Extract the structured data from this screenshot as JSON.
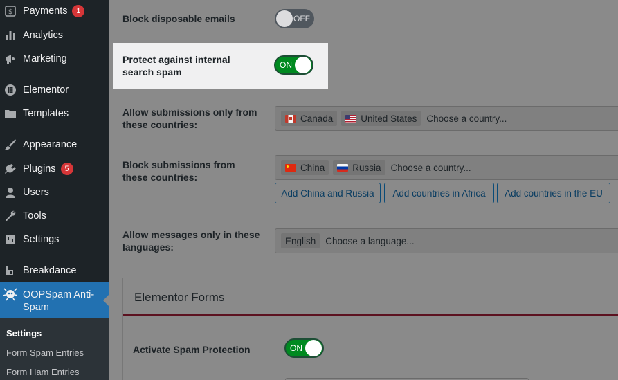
{
  "sidebar": {
    "items": [
      {
        "label": "Payments",
        "icon": "payments-icon",
        "badge": "1"
      },
      {
        "label": "Analytics",
        "icon": "analytics-icon"
      },
      {
        "label": "Marketing",
        "icon": "marketing-icon"
      },
      {
        "label": "Elementor",
        "icon": "elementor-icon"
      },
      {
        "label": "Templates",
        "icon": "folder-icon"
      },
      {
        "label": "Appearance",
        "icon": "brush-icon"
      },
      {
        "label": "Plugins",
        "icon": "plugin-icon",
        "badge": "5"
      },
      {
        "label": "Users",
        "icon": "user-icon"
      },
      {
        "label": "Tools",
        "icon": "wrench-icon"
      },
      {
        "label": "Settings",
        "icon": "settings-icon"
      },
      {
        "label": "Breakdance",
        "icon": "breakdance-icon"
      },
      {
        "label": "OOPSpam Anti-Spam",
        "icon": "oopspam-icon"
      }
    ],
    "submenu": [
      {
        "label": "Settings"
      },
      {
        "label": "Form Spam Entries"
      },
      {
        "label": "Form Ham Entries"
      }
    ]
  },
  "settings": {
    "block_disposable": {
      "label": "Block disposable emails",
      "state": "OFF"
    },
    "internal_search": {
      "label": "Protect against internal search spam",
      "state": "ON"
    },
    "allow_countries": {
      "label": "Allow submissions only from these countries:",
      "chips": [
        "Canada",
        "United States"
      ],
      "placeholder": "Choose a country..."
    },
    "block_countries": {
      "label": "Block submissions from these countries:",
      "chips": [
        "China",
        "Russia"
      ],
      "placeholder": "Choose a country...",
      "buttons": [
        "Add China and Russia",
        "Add countries in Africa",
        "Add countries in the EU"
      ]
    },
    "languages": {
      "label": "Allow messages only in these languages:",
      "chips": [
        "English"
      ],
      "placeholder": "Choose a language..."
    }
  },
  "elementor": {
    "title": "Elementor Forms",
    "activate": {
      "label": "Activate Spam Protection",
      "state": "ON"
    }
  },
  "colors": {
    "sidebar_bg": "#1d2327",
    "active_menu": "#2271b1",
    "toggle_on": "#008a20",
    "badge": "#d63638",
    "elementor_accent": "#5c1220"
  }
}
